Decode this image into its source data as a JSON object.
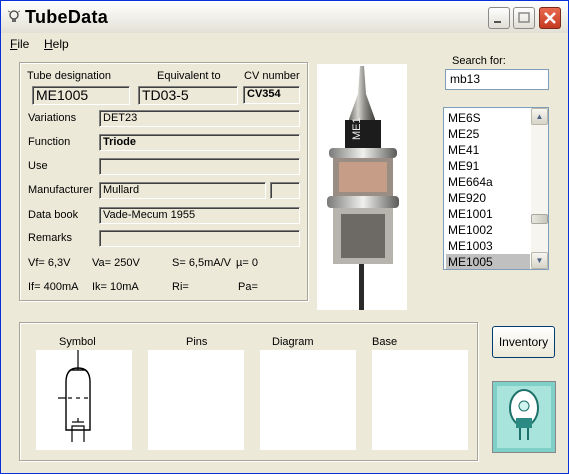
{
  "window": {
    "title": "TubeData"
  },
  "menu": [
    {
      "label": "File",
      "underline": "F",
      "rest": "ile"
    },
    {
      "label": "Help",
      "underline": "H",
      "rest": "elp"
    }
  ],
  "details": {
    "designation_label": "Tube designation",
    "designation": "ME1005",
    "equivalent_label": "Equivalent to",
    "equivalent": "TD03-5",
    "cv_label": "CV number",
    "cv": "CV354",
    "variations_label": "Variations",
    "variations": "DET23",
    "function_label": "Function",
    "function": "Triode",
    "use_label": "Use",
    "use": "",
    "manufacturer_label": "Manufacturer",
    "manufacturer": "Mullard",
    "manufacturer_extra": "",
    "databook_label": "Data book",
    "databook": "Vade-Mecum 1955",
    "remarks_label": "Remarks",
    "remarks": ""
  },
  "params": {
    "vf": "Vf= 6,3V",
    "va": "Va= 250V",
    "s": "S= 6,5mA/V",
    "mu": "µ=   0",
    "if": "If= 400mA",
    "ik": "Ik=  10mA",
    "ri": "Ri=",
    "pa": "Pa="
  },
  "search": {
    "label": "Search for:",
    "value": "mb13"
  },
  "tube_list": {
    "items": [
      "ME6S",
      "ME25",
      "ME41",
      "ME91",
      "ME664a",
      "ME920",
      "ME1001",
      "ME1002",
      "ME1003",
      "ME1005"
    ],
    "selected": "ME1005"
  },
  "panes": {
    "symbol": "Symbol",
    "pins": "Pins",
    "diagram": "Diagram",
    "base": "Base"
  },
  "inventory_label": "Inventory",
  "colors": {
    "window_bg": "#ece9d8",
    "selection": "#c0c0c0",
    "close_button": "#c43b20"
  }
}
